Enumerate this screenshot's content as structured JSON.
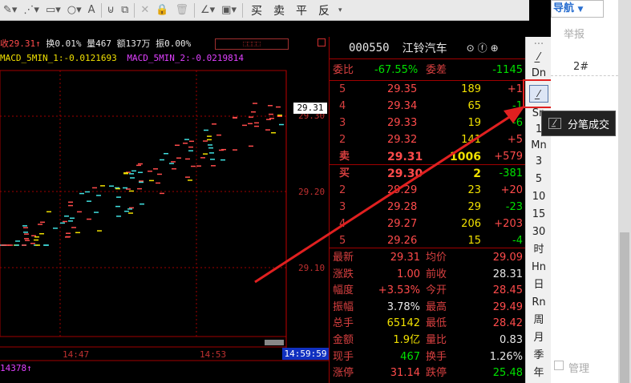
{
  "toolbar": {
    "buttons": [
      {
        "name": "pen-tool-icon",
        "glyph": "✎▾"
      },
      {
        "name": "line-tool-icon",
        "glyph": "⋰▾"
      },
      {
        "name": "rectangle-tool-icon",
        "glyph": "▭▾"
      },
      {
        "name": "circle-tool-icon",
        "glyph": "○▾"
      },
      {
        "name": "text-tool-icon",
        "glyph": "A"
      },
      {
        "name": "magnet-icon",
        "glyph": "⊍"
      },
      {
        "name": "copy-icon",
        "glyph": "⧉"
      },
      {
        "name": "delete-icon",
        "glyph": "✕"
      },
      {
        "name": "lock-icon",
        "glyph": "🔒"
      },
      {
        "name": "trash-icon",
        "glyph": "🗑"
      },
      {
        "name": "color-icon",
        "glyph": "∠▾"
      },
      {
        "name": "save-icon",
        "glyph": "▣▾"
      }
    ],
    "trade": {
      "buy": "买",
      "sell": "卖",
      "flat": "平",
      "reverse": "反"
    }
  },
  "chart": {
    "info1": {
      "close": "收29.31",
      "close_arrow": "↑",
      "turnover": "换0.01%",
      "volume": "量467",
      "amount": "额137万",
      "amp": "振0.00%"
    },
    "info2": {
      "macd1": "MACD_5MIN_1:-0.0121693",
      "macd2": "MACD_5MIN_2:-0.0219814"
    },
    "price_labels": [
      "29.30",
      "29.20",
      "29.10"
    ],
    "current_price": "29.31",
    "time_labels": [
      "14:47",
      "14:53",
      "14:59:59"
    ],
    "bottom_value": "14378",
    "bottom_arrow": "↑"
  },
  "quote": {
    "code": "000550",
    "name": "江铃汽车",
    "webi": {
      "label": "委比",
      "value": "-67.55%",
      "diff_label": "委差",
      "diff": "-1145"
    },
    "sells": [
      {
        "label": "5",
        "price": "29.35",
        "vol": "189",
        "chg": "+1"
      },
      {
        "label": "4",
        "price": "29.34",
        "vol": "65",
        "chg": "-1"
      },
      {
        "label": "3",
        "price": "29.33",
        "vol": "19",
        "chg": "-6"
      },
      {
        "label": "2",
        "price": "29.32",
        "vol": "141",
        "chg": "+5"
      },
      {
        "label": "卖",
        "price": "29.31",
        "vol": "1006",
        "chg": "+579"
      }
    ],
    "buys": [
      {
        "label": "买",
        "price": "29.30",
        "vol": "2",
        "chg": "-381"
      },
      {
        "label": "2",
        "price": "29.29",
        "vol": "23",
        "chg": "+20"
      },
      {
        "label": "3",
        "price": "29.28",
        "vol": "29",
        "chg": "-23"
      },
      {
        "label": "4",
        "price": "29.27",
        "vol": "206",
        "chg": "+203"
      },
      {
        "label": "5",
        "price": "29.26",
        "vol": "15",
        "chg": "-4"
      }
    ],
    "stats": [
      {
        "l1": "最新",
        "v1": "29.31",
        "c1": "red",
        "l2": "均价",
        "v2": "29.09",
        "c2": "red"
      },
      {
        "l1": "涨跌",
        "v1": "1.00",
        "c1": "red",
        "l2": "前收",
        "v2": "28.31",
        "c2": "wht"
      },
      {
        "l1": "幅度",
        "v1": "+3.53%",
        "c1": "red",
        "l2": "今开",
        "v2": "28.45",
        "c2": "red"
      },
      {
        "l1": "振幅",
        "v1": "3.78%",
        "c1": "wht",
        "l2": "最高",
        "v2": "29.49",
        "c2": "red"
      },
      {
        "l1": "总手",
        "v1": "65142",
        "c1": "yel",
        "l2": "最低",
        "v2": "28.42",
        "c2": "red"
      },
      {
        "l1": "金额",
        "v1": "1.9亿",
        "c1": "yel",
        "l2": "量比",
        "v2": "0.83",
        "c2": "wht"
      },
      {
        "l1": "现手",
        "v1": "467",
        "c1": "grn",
        "l2": "换手",
        "v2": "1.26%",
        "c2": "wht"
      },
      {
        "l1": "涨停",
        "v1": "31.14",
        "c1": "red",
        "l2": "跌停",
        "v2": "25.48",
        "c2": "grn"
      }
    ]
  },
  "side": {
    "items": [
      "Dn",
      "Sn",
      "1",
      "Mn",
      "3",
      "5",
      "10",
      "15",
      "30",
      "时",
      "Hn",
      "日",
      "Rn",
      "周",
      "月",
      "季",
      "年"
    ],
    "highlighted_icon": "tick-chart-icon"
  },
  "tooltip": {
    "label": "分笔成交"
  },
  "right_panel": {
    "nav": "导航",
    "report": "举报",
    "floor": "2#",
    "manage": "管理"
  },
  "colors": {
    "accent_red": "#e02020",
    "up": "#ff4b4b",
    "down": "#00e000",
    "volume": "#f0e000"
  }
}
